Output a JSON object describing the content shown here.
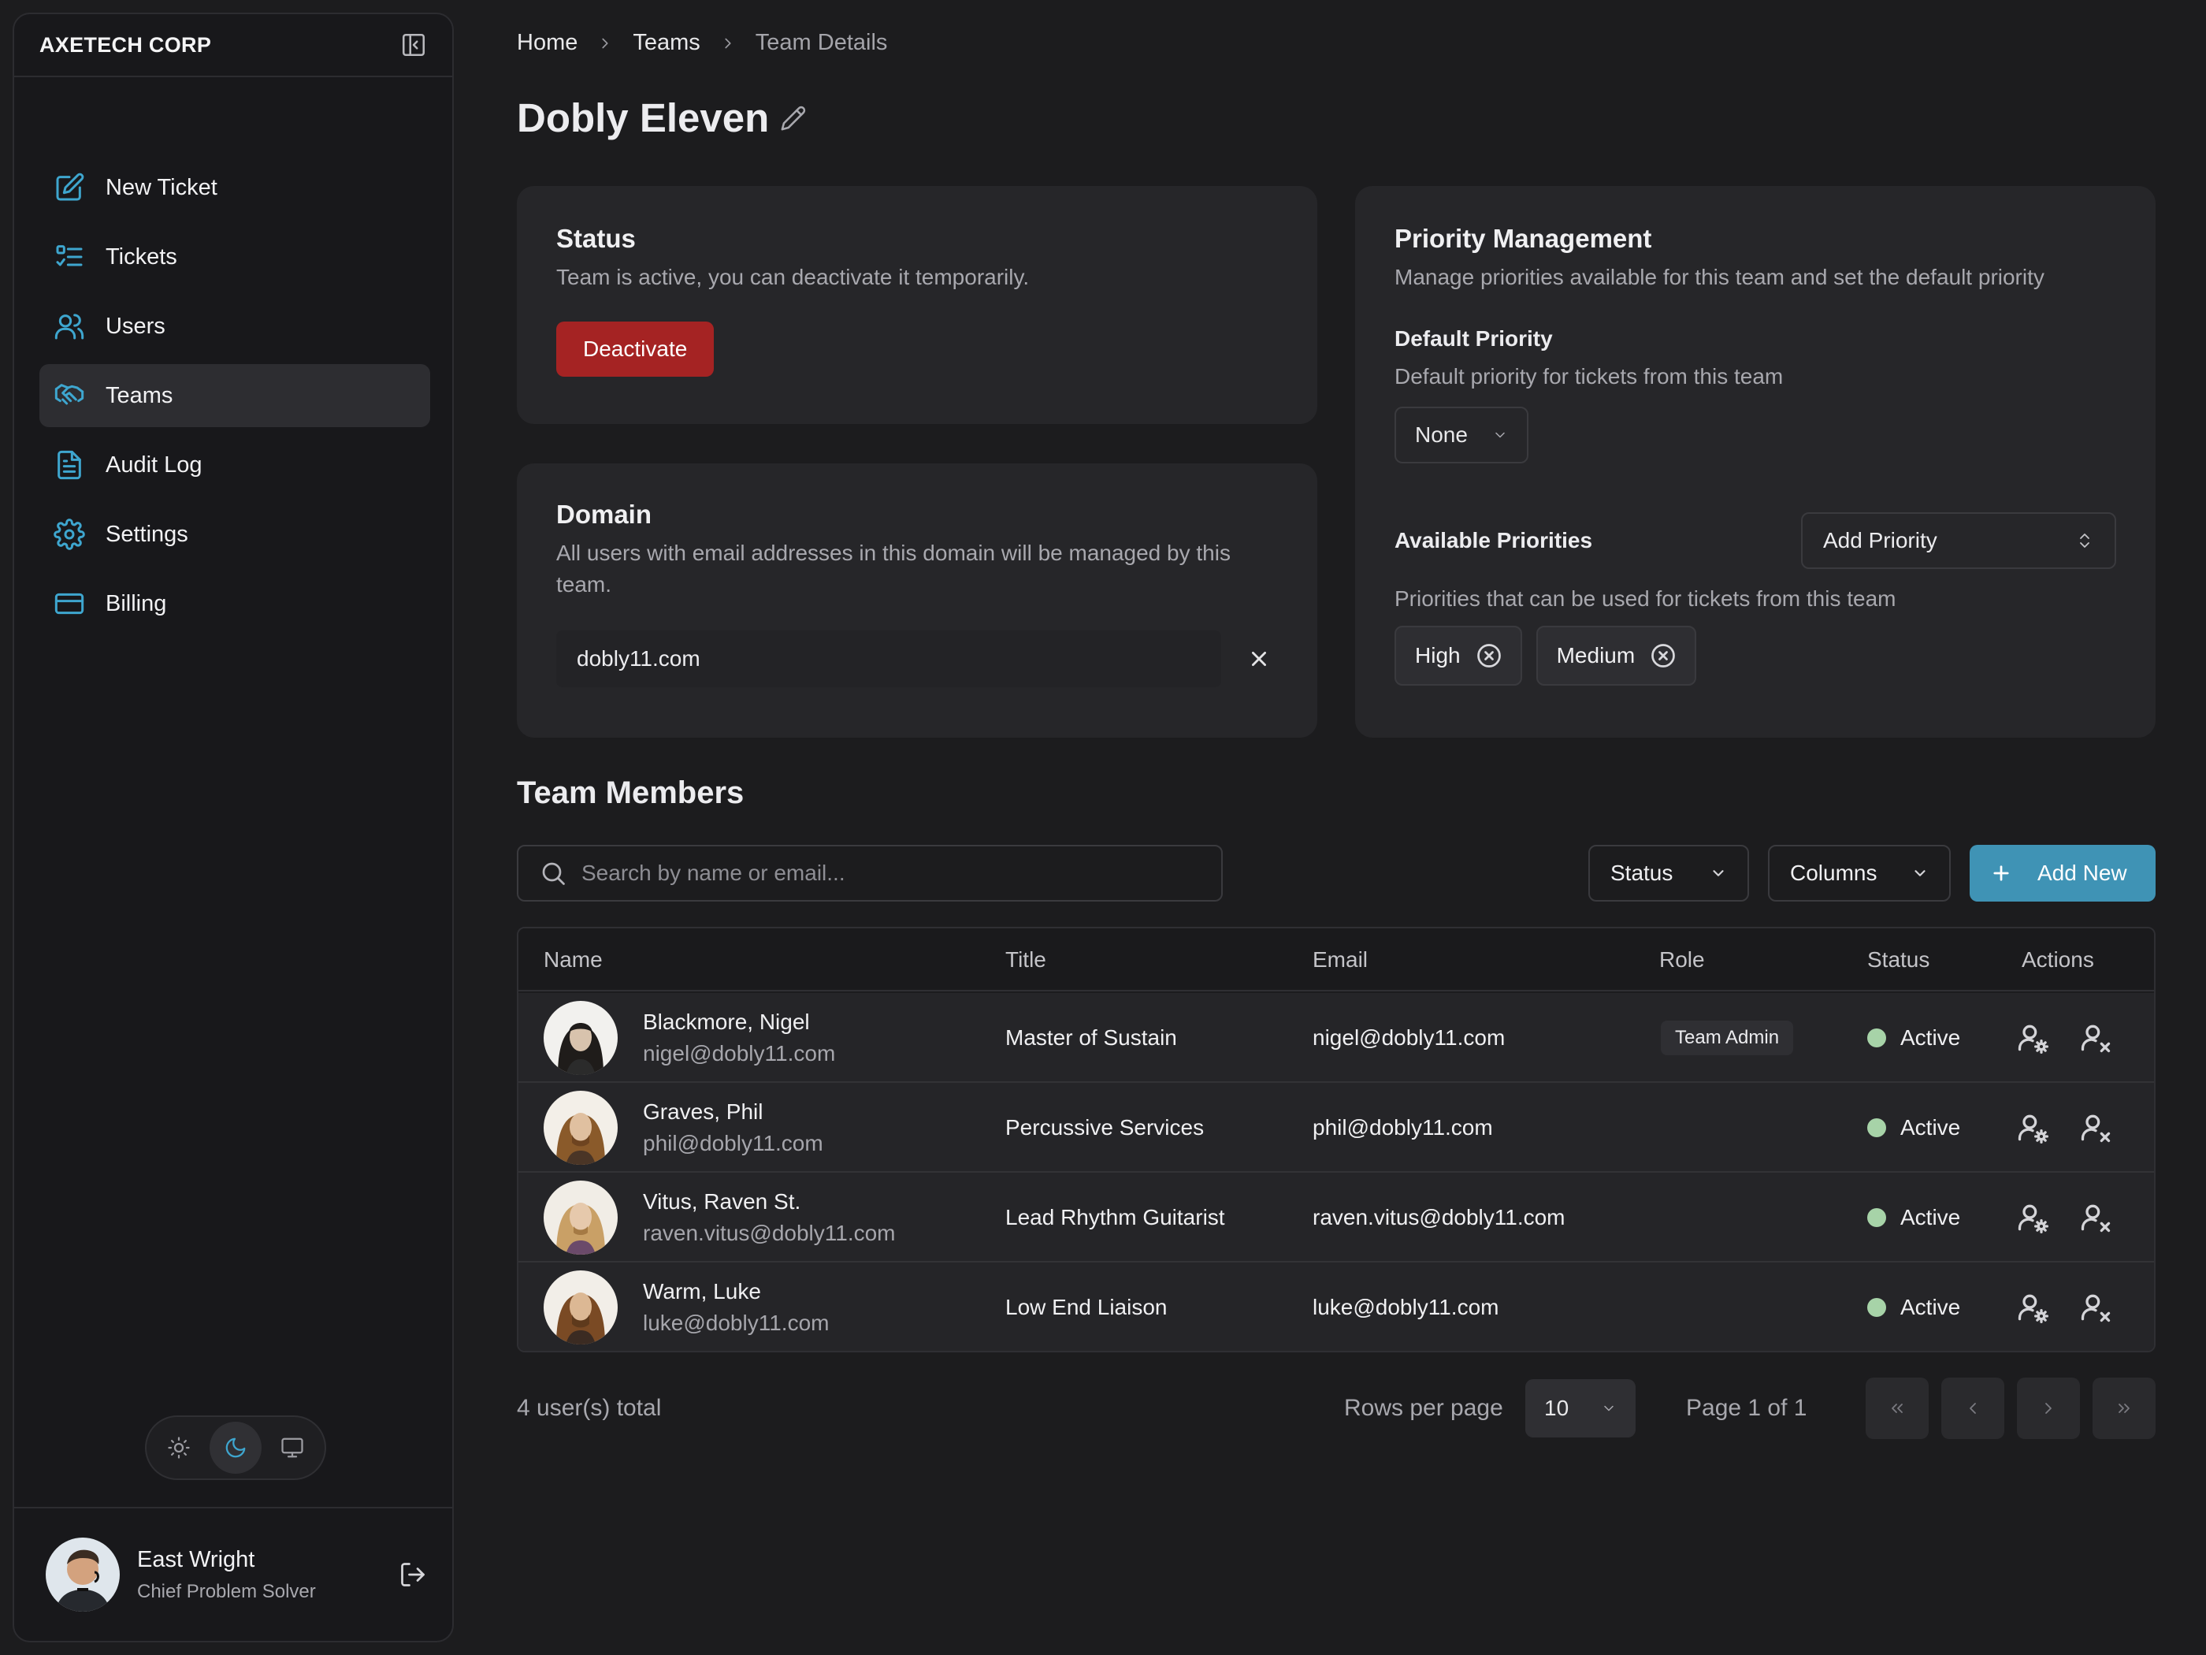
{
  "sidebar": {
    "brand": "AXETECH CORP",
    "items": [
      {
        "label": "New Ticket",
        "icon": "edit-square-icon"
      },
      {
        "label": "Tickets",
        "icon": "list-checks-icon"
      },
      {
        "label": "Users",
        "icon": "users-icon"
      },
      {
        "label": "Teams",
        "icon": "handshake-icon",
        "active": true
      },
      {
        "label": "Audit Log",
        "icon": "document-icon"
      },
      {
        "label": "Settings",
        "icon": "gear-icon"
      },
      {
        "label": "Billing",
        "icon": "credit-card-icon"
      }
    ],
    "theme": {
      "selected": "dark",
      "options": [
        "light",
        "dark",
        "system"
      ]
    },
    "user": {
      "name": "East Wright",
      "role": "Chief Problem Solver"
    }
  },
  "breadcrumb": [
    "Home",
    "Teams",
    "Team Details"
  ],
  "page": {
    "title": "Dobly Eleven"
  },
  "status_card": {
    "title": "Status",
    "description": "Team is active, you can deactivate it temporarily.",
    "button": "Deactivate"
  },
  "domain_card": {
    "title": "Domain",
    "description": "All users with email addresses in this domain will be managed by this team.",
    "value": "dobly11.com"
  },
  "priority_card": {
    "title": "Priority Management",
    "description": "Manage priorities available for this team and set the default priority",
    "default_label": "Default Priority",
    "default_description": "Default priority for tickets from this team",
    "default_value": "None",
    "available_label": "Available Priorities",
    "add_label": "Add Priority",
    "available_description": "Priorities that can be used for tickets from this team",
    "chips": [
      "High",
      "Medium"
    ]
  },
  "members": {
    "title": "Team Members",
    "search_placeholder": "Search by name or email...",
    "status_filter": "Status",
    "columns_button": "Columns",
    "add_button": "Add New",
    "columns": [
      "Name",
      "Title",
      "Email",
      "Role",
      "Status",
      "Actions"
    ],
    "rows": [
      {
        "name": "Blackmore, Nigel",
        "sub_email": "nigel@dobly11.com",
        "title": "Master of Sustain",
        "email": "nigel@dobly11.com",
        "role": "Team Admin",
        "status": "Active"
      },
      {
        "name": "Graves, Phil",
        "sub_email": "phil@dobly11.com",
        "title": "Percussive Services",
        "email": "phil@dobly11.com",
        "role": "",
        "status": "Active"
      },
      {
        "name": "Vitus, Raven St.",
        "sub_email": "raven.vitus@dobly11.com",
        "title": "Lead Rhythm Guitarist",
        "email": "raven.vitus@dobly11.com",
        "role": "",
        "status": "Active"
      },
      {
        "name": "Warm, Luke",
        "sub_email": "luke@dobly11.com",
        "title": "Low End Liaison",
        "email": "luke@dobly11.com",
        "role": "",
        "status": "Active"
      }
    ],
    "total": "4 user(s) total",
    "rows_per_page_label": "Rows per page",
    "rows_per_page": "10",
    "page_info": "Page 1 of 1"
  },
  "colors": {
    "accent": "#3ea6cf",
    "danger": "#a52323",
    "primary_button": "#3f93b5",
    "status_active": "#a7d3a8"
  }
}
